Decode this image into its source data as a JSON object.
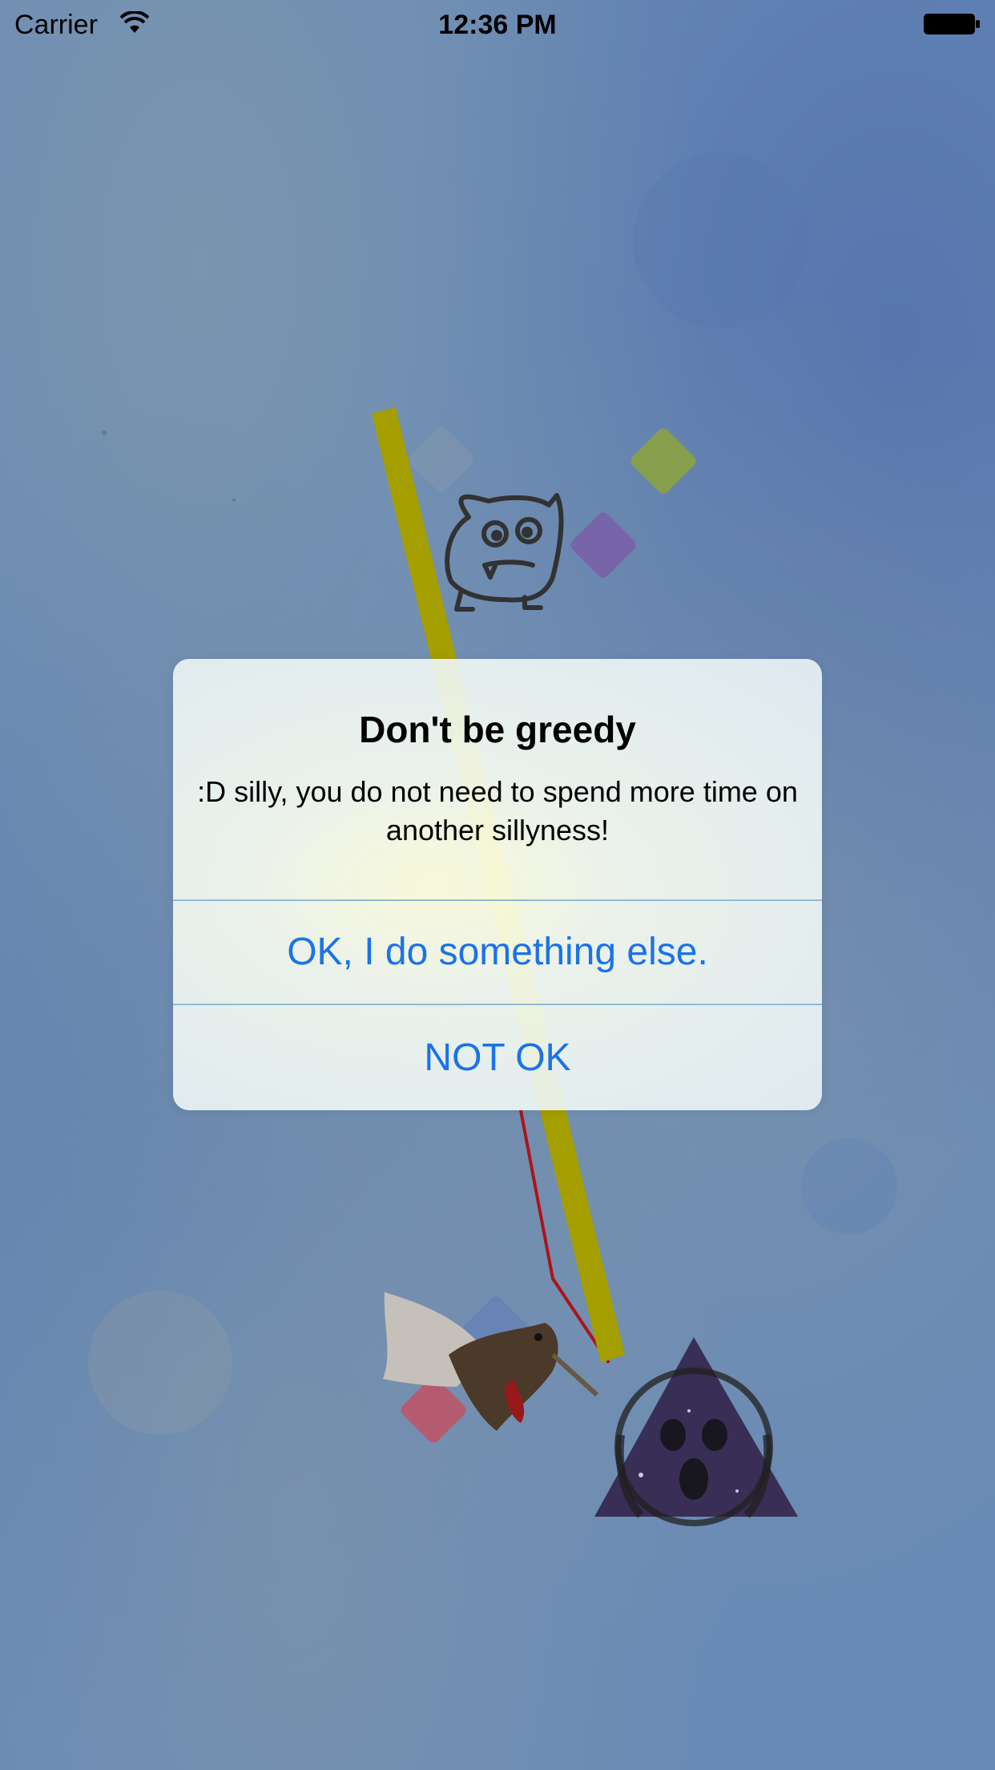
{
  "status_bar": {
    "carrier": "Carrier",
    "time": "12:36 PM"
  },
  "scene": {
    "icons": [
      "monster-doodle-icon",
      "hummingbird-icon",
      "screaming-face-triangle-icon"
    ],
    "colors": {
      "pole": "#a8a200",
      "red_line": "#b0151c",
      "diamond_gray": "#7f97b3",
      "diamond_green": "#8aa24f",
      "diamond_purple": "#7b66ad",
      "diamond_blue": "#6b87b8",
      "diamond_red": "#c0586b"
    }
  },
  "alert": {
    "title": "Don't be greedy",
    "message": ":D silly, you do not need to spend more time on another sillyness!",
    "buttons": {
      "ok": "OK, I do something else.",
      "not_ok": "NOT OK"
    },
    "accent": "#1a73e8"
  }
}
